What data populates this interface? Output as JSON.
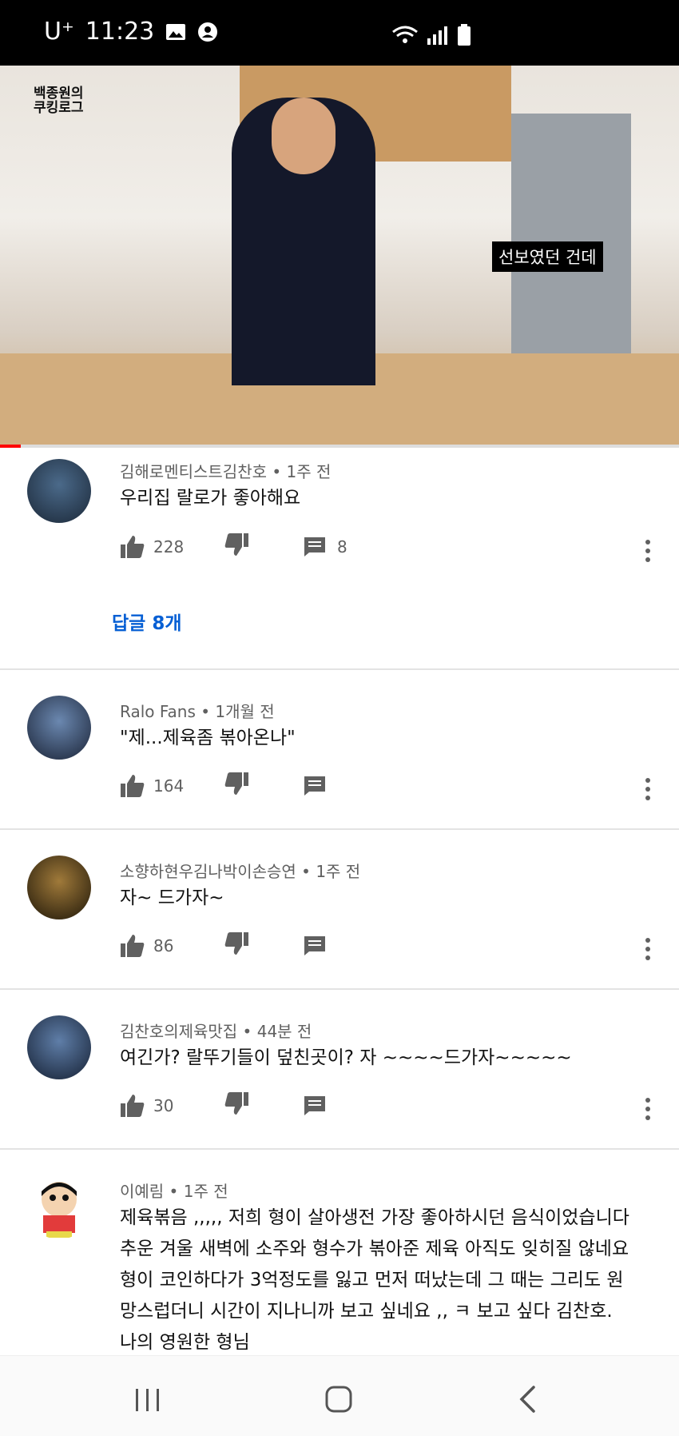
{
  "status_bar": {
    "carrier": "U⁺",
    "time": "11:23"
  },
  "video": {
    "logo_line1": "백종원의",
    "logo_line2": "쿠킹로그",
    "subtitle": "선보였던 건데",
    "progress_percent": 3
  },
  "comments": [
    {
      "author": "김해로멘티스트김찬호",
      "time": "1주 전",
      "text": "우리집 랄로가 좋아해요",
      "likes": "228",
      "reply_count": "8",
      "replies_link": "답글 8개"
    },
    {
      "author": "Ralo Fans",
      "time": "1개월 전",
      "text": "\"제...제육좀 볶아온나\"",
      "likes": "164"
    },
    {
      "author": "소향하현우김나박이손승연",
      "time": "1주 전",
      "text": "자~ 드가자~",
      "likes": "86"
    },
    {
      "author": "김찬호의제육맛집",
      "time": "44분 전",
      "text": "여긴가? 랄뚜기들이 덮친곳이? 자 ~~~~드가자~~~~~",
      "likes": "30"
    },
    {
      "author": "이예림",
      "time": "1주 전",
      "text": "제육볶음 ,,,,, 저희 형이 살아생전 가장 좋아하시던 음식이었습니다 추운 겨울 새벽에 소주와 형수가 볶아준 제육 아직도 잊히질 않네요 형이 코인하다가 3억정도를 잃고 먼저 떠났는데 그 때는 그리도 원망스럽더니 시간이 지나니까 보고 싶네요 ,, ㅋ 보고 싶다 김찬호. 나의 영원한 형님"
    }
  ],
  "colors": {
    "link": "#065fd4",
    "meta": "#606060",
    "progress": "#ff0000"
  },
  "icons": [
    "gallery-icon",
    "account-icon",
    "wifi-icon",
    "signal-icon",
    "battery-icon",
    "thumb-up-icon",
    "thumb-down-icon",
    "comment-icon",
    "more-vert-icon",
    "recent-apps-icon",
    "home-icon",
    "back-icon"
  ]
}
